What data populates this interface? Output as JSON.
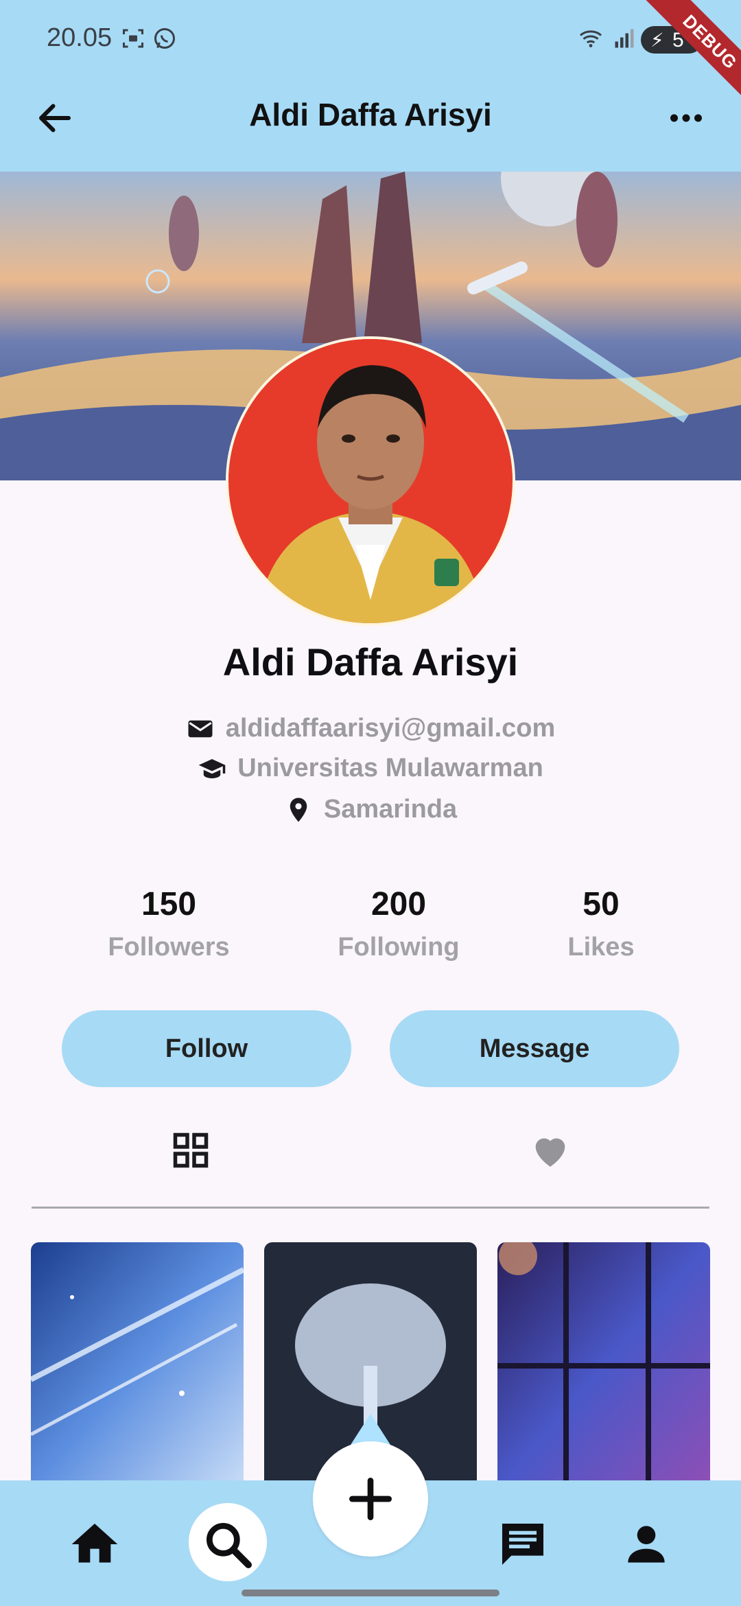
{
  "status_bar": {
    "time": "20.05",
    "battery": "5",
    "debug_label": "DEBUG"
  },
  "app_bar": {
    "title": "Aldi Daffa Arisyi"
  },
  "profile": {
    "name": "Aldi Daffa Arisyi",
    "email": "aldidaffaarisyi@gmail.com",
    "university": "Universitas Mulawarman",
    "location": "Samarinda"
  },
  "stats": [
    {
      "value": "150",
      "label": "Followers"
    },
    {
      "value": "200",
      "label": "Following"
    },
    {
      "value": "50",
      "label": "Likes"
    }
  ],
  "actions": {
    "follow": "Follow",
    "message": "Message"
  },
  "tabs": [
    {
      "icon": "grid-icon",
      "active": true
    },
    {
      "icon": "heart-icon",
      "active": false
    }
  ],
  "nav": [
    "home-icon",
    "search-icon",
    "add-icon",
    "chat-icon",
    "person-icon"
  ],
  "colors": {
    "accent": "#a7daf5",
    "background": "#fbf6fb",
    "avatar_bg": "#e63b2a"
  }
}
